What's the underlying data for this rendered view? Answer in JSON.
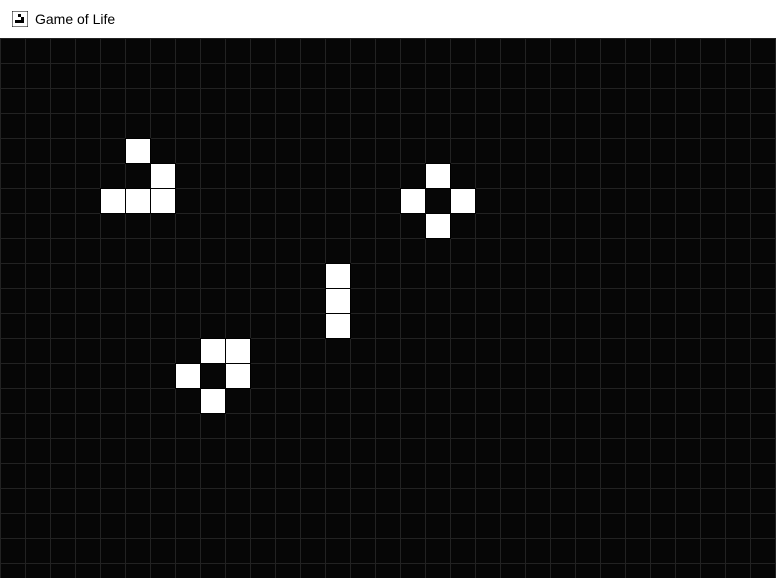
{
  "window": {
    "title": "Game of Life",
    "icon": "game-of-life-icon"
  },
  "board": {
    "columns": 31,
    "rows": 22,
    "colors": {
      "background": "#060606",
      "grid": "#222222",
      "live_cell": "#ffffff",
      "cell_border": "#000000"
    },
    "live_cells": [
      [
        5,
        4
      ],
      [
        6,
        5
      ],
      [
        4,
        6
      ],
      [
        5,
        6
      ],
      [
        6,
        6
      ],
      [
        17,
        5
      ],
      [
        16,
        6
      ],
      [
        18,
        6
      ],
      [
        17,
        7
      ],
      [
        13,
        9
      ],
      [
        13,
        10
      ],
      [
        13,
        11
      ],
      [
        8,
        12
      ],
      [
        9,
        12
      ],
      [
        7,
        13
      ],
      [
        9,
        13
      ],
      [
        8,
        14
      ]
    ]
  }
}
